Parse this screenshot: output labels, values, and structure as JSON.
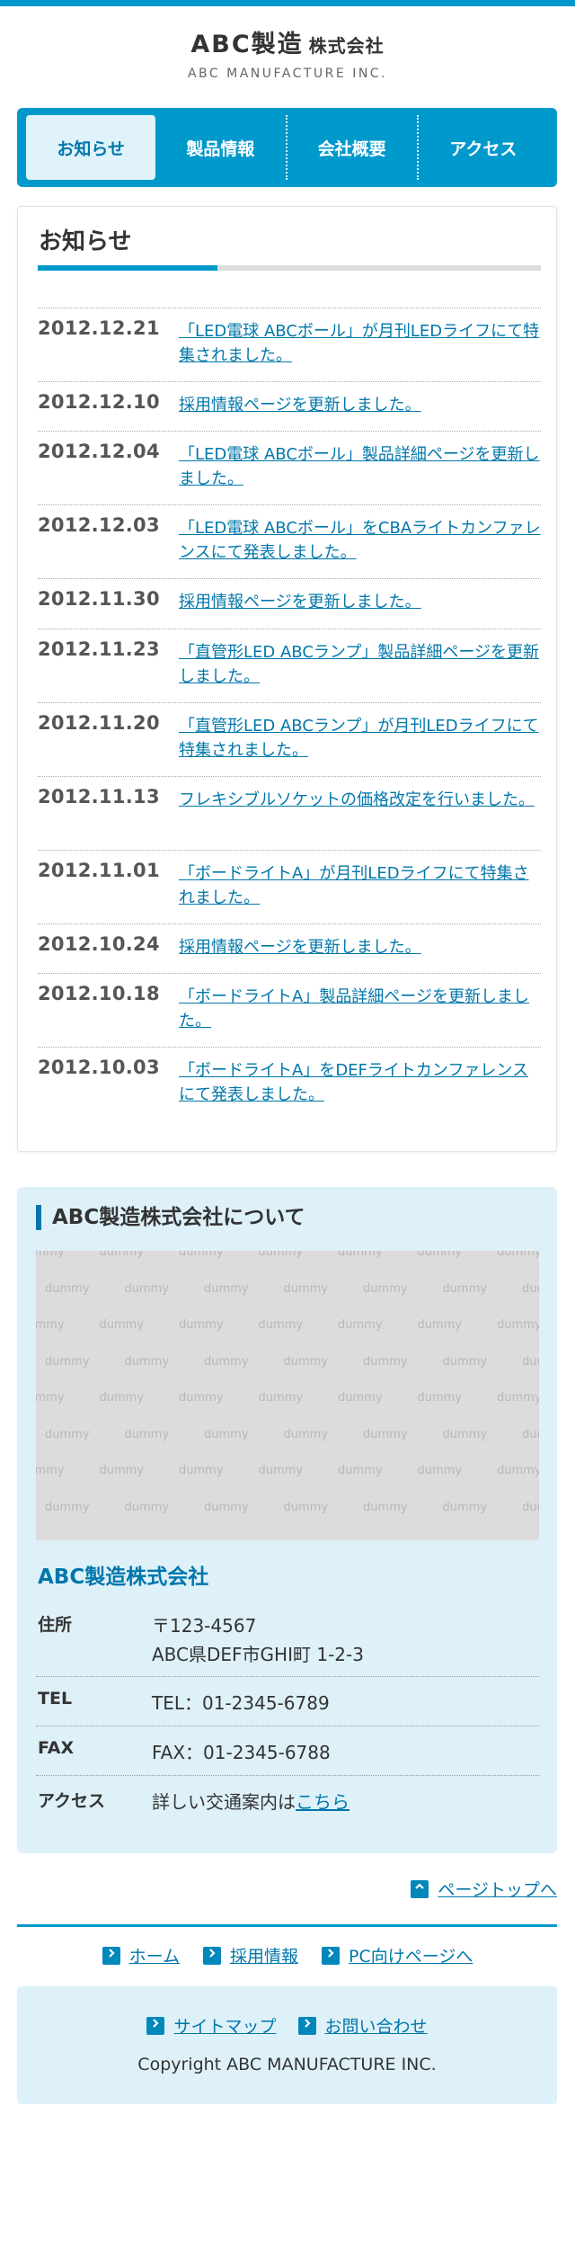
{
  "header": {
    "logo_main": "ABC製造",
    "logo_suffix": "株式会社",
    "logo_sub": "ABC MANUFACTURE INC."
  },
  "nav": {
    "items": [
      {
        "label": "お知らせ"
      },
      {
        "label": "製品情報"
      },
      {
        "label": "会社概要"
      },
      {
        "label": "アクセス"
      }
    ],
    "active": "お知らせ"
  },
  "news": {
    "title": "お知らせ",
    "items": [
      {
        "date": "2012.12.21",
        "text": "「LED電球 ABCボール」が月刊LEDライフにて特集されました。"
      },
      {
        "date": "2012.12.10",
        "text": "採用情報ページを更新しました。"
      },
      {
        "date": "2012.12.04",
        "text": "「LED電球 ABCボール」製品詳細ページを更新しました。"
      },
      {
        "date": "2012.12.03",
        "text": "「LED電球 ABCボール」をCBAライトカンファレンスにて発表しました。"
      },
      {
        "date": "2012.11.30",
        "text": "採用情報ページを更新しました。"
      },
      {
        "date": "2012.11.23",
        "text": "「直管形LED ABCランプ」製品詳細ページを更新しました。"
      },
      {
        "date": "2012.11.20",
        "text": "「直管形LED ABCランプ」が月刊LEDライフにて特集されました。"
      },
      {
        "date": "2012.11.13",
        "text": "フレキシブルソケットの価格改定を行いました。"
      },
      {
        "date": "2012.11.01",
        "text": "「ボードライトA」が月刊LEDライフにて特集されました。"
      },
      {
        "date": "2012.10.24",
        "text": "採用情報ページを更新しました。"
      },
      {
        "date": "2012.10.18",
        "text": "「ボードライトA」製品詳細ページを更新しました。"
      },
      {
        "date": "2012.10.03",
        "text": "「ボードライトA」をDEFライトカンファレンスにて発表しました。"
      }
    ]
  },
  "about": {
    "heading": "ABC製造株式会社について",
    "image_placeholder_word": "dummy",
    "company_name": "ABC製造株式会社",
    "address_label": "住所",
    "address_line1": "〒123-4567",
    "address_line2": "ABC県DEF市GHI町 1-2-3",
    "tel_label": "TEL",
    "tel_value": "TEL：01-2345-6789",
    "fax_label": "FAX",
    "fax_value": "FAX：01-2345-6788",
    "access_label": "アクセス",
    "access_text": "詳しい交通案内は",
    "access_link": "こちら"
  },
  "pagetop": {
    "label": "ページトップへ"
  },
  "footer": {
    "nav": [
      {
        "label": "ホーム"
      },
      {
        "label": "採用情報"
      },
      {
        "label": "PC向けページへ"
      }
    ],
    "sub": [
      {
        "label": "サイトマップ"
      },
      {
        "label": "お問い合わせ"
      }
    ],
    "copyright": "Copyright ABC MANUFACTURE INC."
  },
  "colors": {
    "brand": "#0099cc",
    "link": "#0077aa",
    "panel_bg": "#def1f9",
    "nav_active_bg": "#e0f3fb"
  }
}
